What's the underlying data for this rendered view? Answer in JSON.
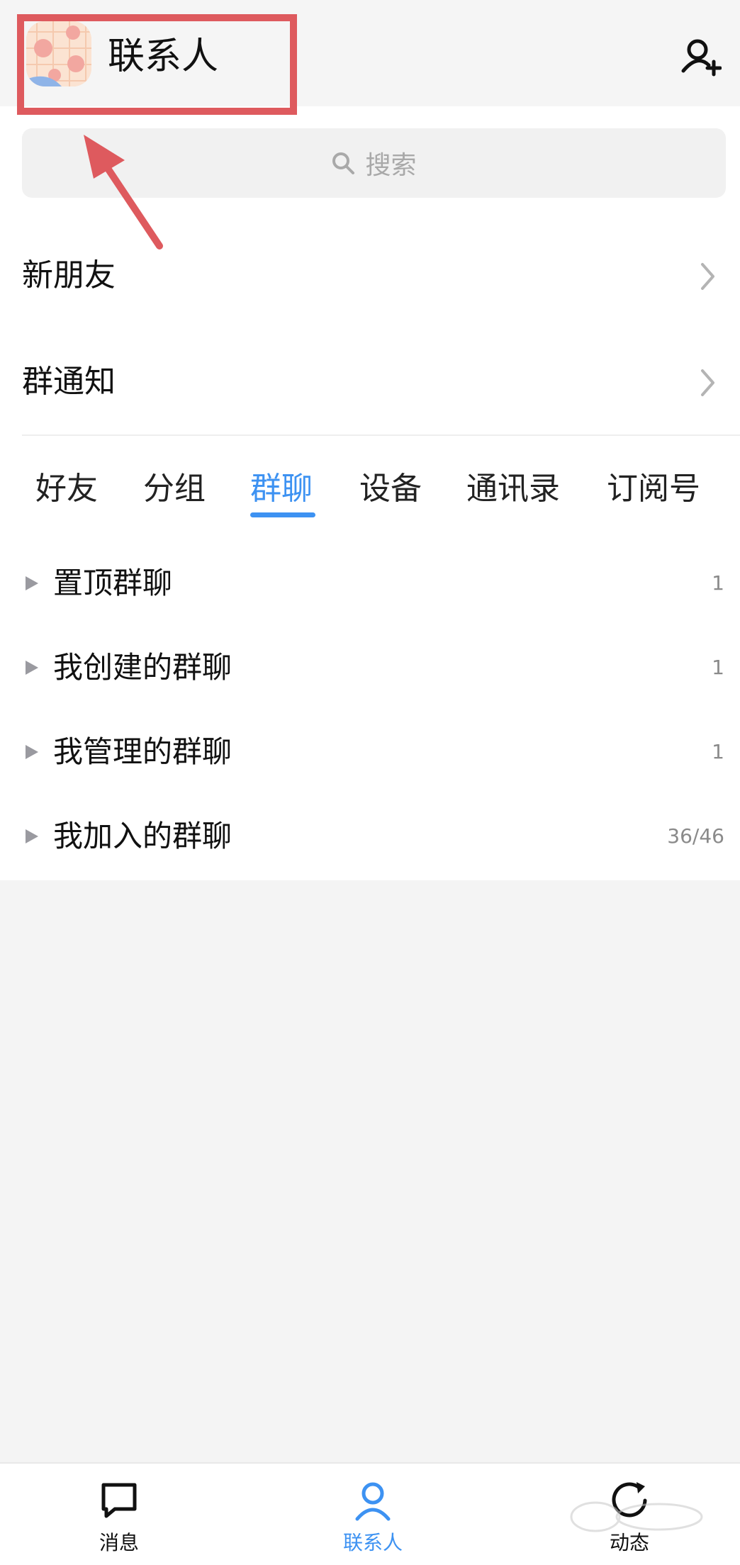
{
  "header": {
    "title": "联系人",
    "avatar_icon": "pig-avatar-icon",
    "add_friend_icon": "add-user-icon"
  },
  "search": {
    "placeholder": "搜索",
    "icon": "search-icon"
  },
  "menu": [
    {
      "label": "新朋友",
      "icon": "chevron-right-icon"
    },
    {
      "label": "群通知",
      "icon": "chevron-right-icon"
    }
  ],
  "tabs": [
    {
      "label": "好友",
      "active": false
    },
    {
      "label": "分组",
      "active": false
    },
    {
      "label": "群聊",
      "active": true
    },
    {
      "label": "设备",
      "active": false
    },
    {
      "label": "通讯录",
      "active": false
    },
    {
      "label": "订阅号",
      "active": false
    }
  ],
  "groups": [
    {
      "label": "置顶群聊",
      "count": "1"
    },
    {
      "label": "我创建的群聊",
      "count": "1"
    },
    {
      "label": "我管理的群聊",
      "count": "1"
    },
    {
      "label": "我加入的群聊",
      "count": "36/46"
    }
  ],
  "bottom_nav": [
    {
      "label": "消息",
      "icon": "chat-bubble-icon",
      "active": false
    },
    {
      "label": "联系人",
      "icon": "person-icon",
      "active": true
    },
    {
      "label": "动态",
      "icon": "moments-icon",
      "active": false
    }
  ],
  "colors": {
    "accent": "#3d92f2",
    "annotation": "#de5a5e",
    "background": "#f4f4f4"
  }
}
